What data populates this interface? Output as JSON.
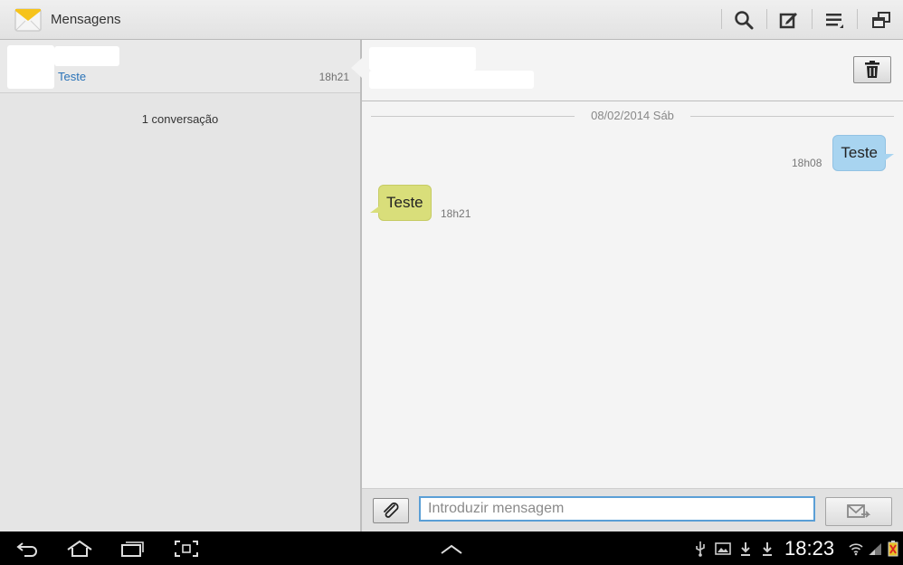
{
  "app": {
    "title": "Mensagens",
    "icon": "envelope-icon"
  },
  "toolbar": {
    "actions": [
      {
        "name": "search-button",
        "icon": "search-icon"
      },
      {
        "name": "compose-button",
        "icon": "compose-icon"
      },
      {
        "name": "menu-button",
        "icon": "menu-icon"
      },
      {
        "name": "multiwindow-button",
        "icon": "windows-icon"
      }
    ]
  },
  "conversation_list": {
    "items": [
      {
        "contact": "",
        "snippet": "Teste",
        "time": "18h21"
      }
    ],
    "count_label": "1 conversação"
  },
  "thread": {
    "contact": "",
    "date_separator": "08/02/2014 Sáb",
    "messages": [
      {
        "direction": "outgoing",
        "text": "Teste",
        "time": "18h08"
      },
      {
        "direction": "incoming",
        "text": "Teste",
        "time": "18h21"
      }
    ]
  },
  "composer": {
    "placeholder": "Introduzir mensagem",
    "value": ""
  },
  "statusbar": {
    "clock": "18:23"
  },
  "colors": {
    "outgoing_bubble": "#a8d4f0",
    "incoming_bubble": "#d9de7a",
    "accent": "#2a73b8"
  }
}
